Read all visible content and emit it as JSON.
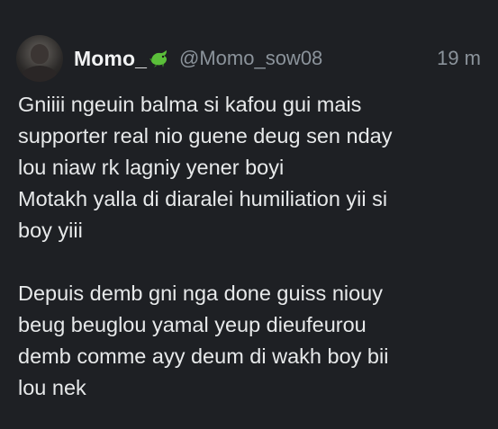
{
  "tweet": {
    "author_name": "Momo_",
    "author_emoji": "green-dragon-emoji",
    "handle": "@Momo_sow08",
    "time": "19 m",
    "paragraph1": [
      "Gniiii ngeuin balma si kafou gui mais",
      "supporter real nio guene deug sen nday",
      "lou niaw rk lagniy yener boyi",
      "Motakh yalla di diaralei humiliation yii si",
      "boy yiii"
    ],
    "paragraph2": [
      "Depuis demb gni nga done guiss niouy",
      "beug beuglou yamal yeup dieufeurou",
      "demb comme ayy deum di wakh boy bii",
      "lou nek"
    ]
  },
  "colors": {
    "background": "#1e2024",
    "text": "#e7e9ea",
    "muted": "#8b939b",
    "emoji_green": "#5bbf3a"
  }
}
